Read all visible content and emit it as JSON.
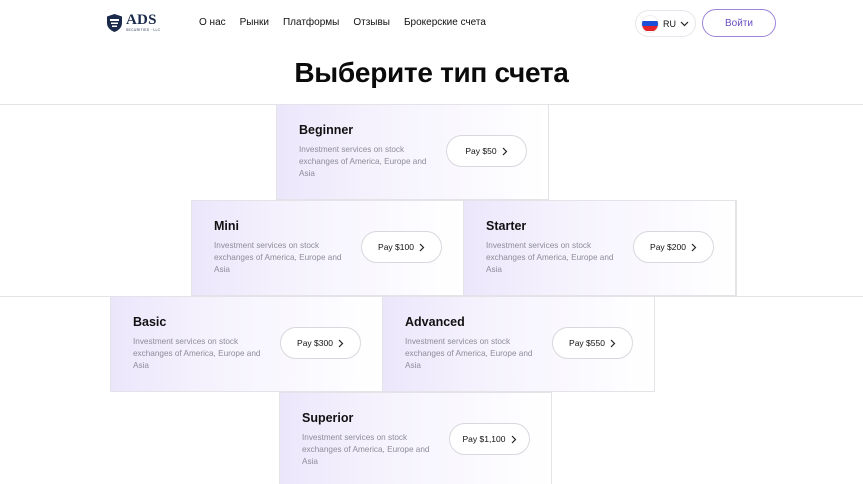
{
  "header": {
    "logo": {
      "main": "ADS",
      "sub": "SECURITIES · LLC",
      "icon": "shield-eagle-icon"
    },
    "nav": [
      "О нас",
      "Рынки",
      "Платформы",
      "Отзывы",
      "Брокерские счета"
    ],
    "language": {
      "code": "RU",
      "flag_icon": "russia-flag-icon",
      "flag_colors": [
        "#ffffff",
        "#1c4fd8",
        "#e5232b"
      ]
    },
    "login_label": "Войти"
  },
  "title": "Выберите тип счета",
  "colors": {
    "accent": "#6a4cc2",
    "card_gradient_start": "#ece6fb",
    "border": "#e3e3e8"
  },
  "cards": [
    {
      "name": "Beginner",
      "description": "Investment services on stock exchanges of America, Europe and Asia",
      "button": "Pay $50"
    },
    {
      "name": "Mini",
      "description": "Investment services on stock exchanges of America, Europe and Asia",
      "button": "Pay $100"
    },
    {
      "name": "Starter",
      "description": "Investment services on stock exchanges of America, Europe and Asia",
      "button": "Pay $200"
    },
    {
      "name": "Basic",
      "description": "Investment services on stock exchanges of America, Europe and Asia",
      "button": "Pay $300"
    },
    {
      "name": "Advanced",
      "description": "Investment services on stock exchanges of America, Europe and Asia",
      "button": "Pay $550"
    },
    {
      "name": "Superior",
      "description": "Investment services on stock exchanges of America, Europe and Asia",
      "button": "Pay $1,100"
    }
  ]
}
